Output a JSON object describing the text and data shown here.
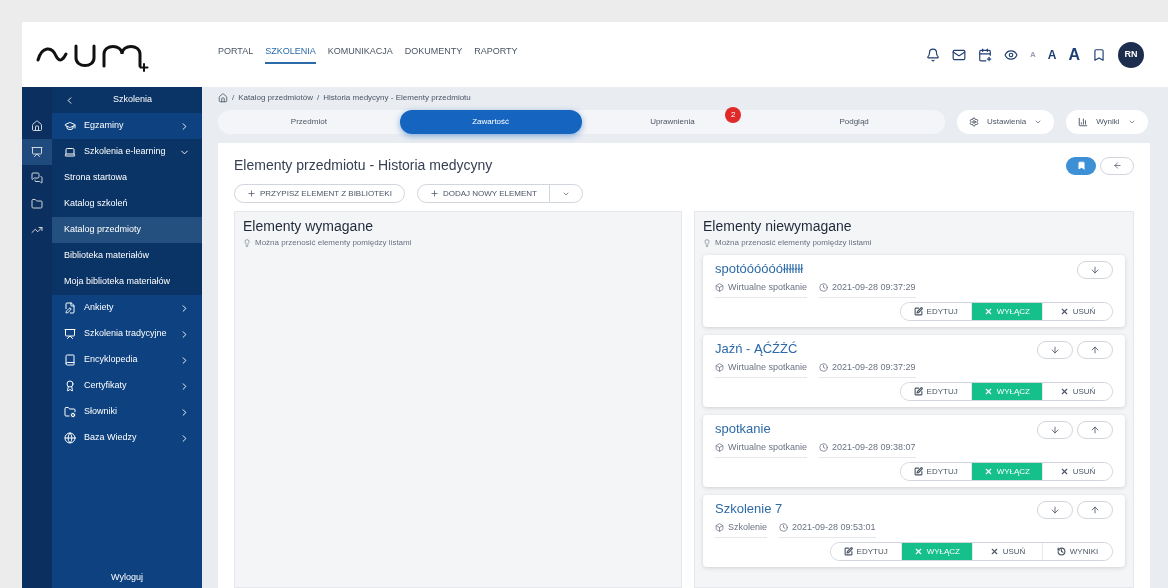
{
  "header": {
    "nav": [
      {
        "label": "PORTAL",
        "selected": false
      },
      {
        "label": "SZKOLENIA",
        "selected": true
      },
      {
        "label": "KOMUNIKACJA",
        "selected": false
      },
      {
        "label": "DOKUMENTY",
        "selected": false
      },
      {
        "label": "RAPORTY",
        "selected": false
      }
    ],
    "font_sizes": [
      "A",
      "A",
      "A"
    ],
    "avatar": "RN"
  },
  "rail": [
    {
      "selected": false
    },
    {
      "selected": true
    },
    {
      "selected": false
    },
    {
      "selected": false
    },
    {
      "selected": false
    }
  ],
  "sidebar": {
    "title": "Szkolenia",
    "items": [
      {
        "label": "Egzaminy",
        "expanded": false
      },
      {
        "label": "Szkolenia e-learning",
        "expanded": true,
        "children": [
          {
            "label": "Strona startowa",
            "selected": false
          },
          {
            "label": "Katalog szkoleń",
            "selected": false
          },
          {
            "label": "Katalog przedmioty",
            "selected": true
          },
          {
            "label": "Biblioteka materiałów",
            "selected": false
          },
          {
            "label": "Moja biblioteka materiałów",
            "selected": false
          }
        ]
      },
      {
        "label": "Ankiety",
        "expanded": false
      },
      {
        "label": "Szkolenia tradycyjne",
        "expanded": false
      },
      {
        "label": "Encyklopedia",
        "expanded": false
      },
      {
        "label": "Certyfikaty",
        "expanded": false
      },
      {
        "label": "Słowniki",
        "expanded": false
      },
      {
        "label": "Baza Wiedzy",
        "expanded": false
      }
    ],
    "logout": "Wyloguj"
  },
  "breadcrumb": {
    "separator": "/",
    "items": [
      "Katalog przedmiotów",
      "Historia medycyny - Elementy przedmiotu"
    ]
  },
  "tabs": [
    {
      "label": "Przedmiot",
      "selected": false
    },
    {
      "label": "Zawartość",
      "selected": true
    },
    {
      "label": "Uprawnienia",
      "selected": false,
      "badge": "2"
    },
    {
      "label": "Podgląd",
      "selected": false
    }
  ],
  "tab_actions": [
    "Ustawienia",
    "Wyniki"
  ],
  "page_title": "Elementy przedmiotu - Historia medycyny",
  "toolbar": {
    "assign": "PRZYPISZ ELEMENT Z BIBLIOTEKI",
    "add": "DODAJ NOWY ELEMENT"
  },
  "required": {
    "title": "Elementy wymagane",
    "hint": "Można przenosić elementy pomiędzy listami"
  },
  "optional": {
    "title": "Elementy niewymagane",
    "hint": "Można przenosić elementy pomiędzy listami",
    "items": [
      {
        "title": "spotóóóóóółłłłłłł",
        "type": "Wirtualne spotkanie",
        "date": "2021-09-28 09:37:29",
        "move_up": false,
        "actions": [
          {
            "kind": "edit",
            "label": "EDYTUJ"
          },
          {
            "kind": "disable",
            "label": "WYŁĄCZ"
          },
          {
            "kind": "delete",
            "label": "USUŃ"
          }
        ]
      },
      {
        "title": "Jaźń - ĄĆŹŻĆ",
        "type": "Wirtualne spotkanie",
        "date": "2021-09-28 09:37:29",
        "move_up": true,
        "actions": [
          {
            "kind": "edit",
            "label": "EDYTUJ"
          },
          {
            "kind": "disable",
            "label": "WYŁĄCZ"
          },
          {
            "kind": "delete",
            "label": "USUŃ"
          }
        ]
      },
      {
        "title": "spotkanie",
        "type": "Wirtualne spotkanie",
        "date": "2021-09-28 09:38:07",
        "move_up": true,
        "actions": [
          {
            "kind": "edit",
            "label": "EDYTUJ"
          },
          {
            "kind": "disable",
            "label": "WYŁĄCZ"
          },
          {
            "kind": "delete",
            "label": "USUŃ"
          }
        ]
      },
      {
        "title": "Szkolenie 7",
        "type": "Szkolenie",
        "date": "2021-09-28 09:53:01",
        "move_up": true,
        "actions": [
          {
            "kind": "edit",
            "label": "EDYTUJ"
          },
          {
            "kind": "disable",
            "label": "WYŁĄCZ"
          },
          {
            "kind": "delete",
            "label": "USUŃ"
          },
          {
            "kind": "results",
            "label": "WYNIKI"
          }
        ]
      }
    ]
  }
}
